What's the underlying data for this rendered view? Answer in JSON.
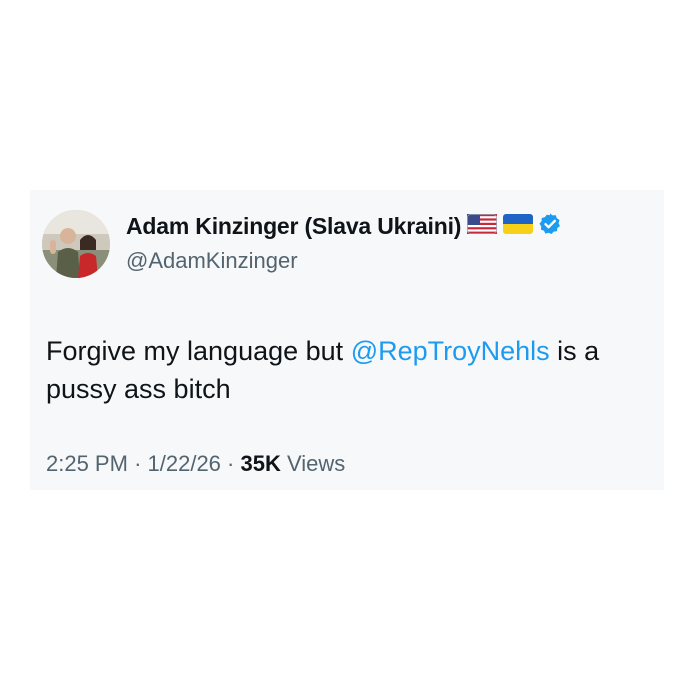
{
  "tweet": {
    "author": {
      "display_name": "Adam Kinzinger (Slava Ukraini)",
      "handle": "@AdamKinzinger",
      "flags": [
        "us-flag-icon",
        "ukraine-flag-icon"
      ],
      "verified": true
    },
    "text": {
      "before_mention": "Forgive my language but ",
      "mention": "@RepTroyNehls",
      "after_mention": " is a pussy ass bitch"
    },
    "meta": {
      "time": "2:25 PM",
      "separator": "·",
      "date": "1/22/26",
      "views_count": "35K",
      "views_label": "Views"
    }
  },
  "colors": {
    "mention": "#1d9bf0",
    "verified_badge": "#1d9bf0",
    "secondary_text": "#536471",
    "primary_text": "#0f1419"
  }
}
